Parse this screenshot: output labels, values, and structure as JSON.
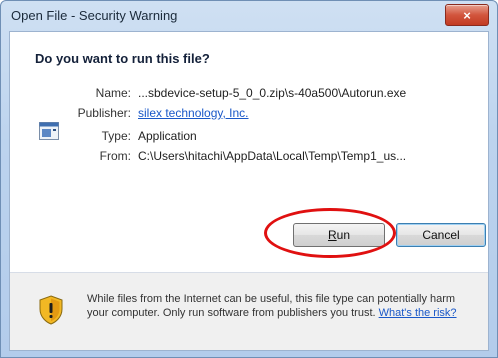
{
  "window": {
    "title": "Open File - Security Warning",
    "close_label": "×"
  },
  "dialog": {
    "heading": "Do you want to run this file?",
    "fields": {
      "name_label": "Name:",
      "name_value": "...sbdevice-setup-5_0_0.zip\\s-40a500\\Autorun.exe",
      "publisher_label": "Publisher:",
      "publisher_value": "silex technology, Inc.",
      "type_label": "Type:",
      "type_value": "Application",
      "from_label": "From:",
      "from_value": "C:\\Users\\hitachi\\AppData\\Local\\Temp\\Temp1_us..."
    },
    "buttons": {
      "run_label": "Run",
      "cancel_label": "Cancel"
    },
    "footer": {
      "text": "While files from the Internet can be useful, this file type can potentially harm your computer. Only run software from publishers you trust.",
      "link": "What's the risk?"
    }
  },
  "colors": {
    "link": "#1a58c8",
    "highlight": "#e01010",
    "close_button": "#c23b22"
  },
  "icons": [
    "application-icon",
    "shield-warning-icon",
    "close-icon"
  ]
}
